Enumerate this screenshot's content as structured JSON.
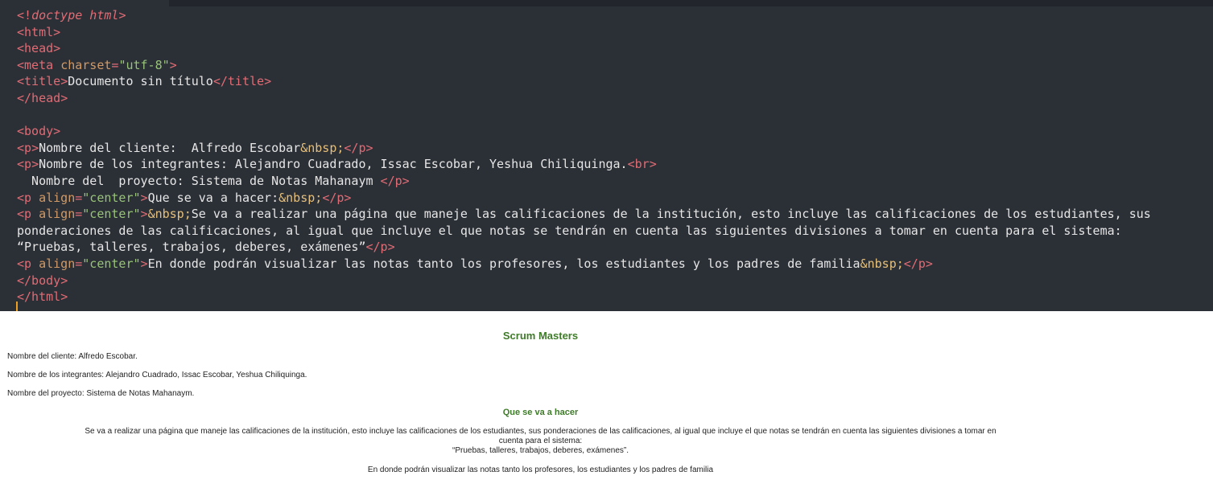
{
  "editor": {
    "lines": [
      "<!doctype html>",
      "<html>",
      "<head>",
      "<meta charset=\"utf-8\">",
      "<title>Documento sin título</title>",
      "</head>",
      "",
      "<body>",
      "<p>Nombre del cliente:  Alfredo Escobar&nbsp;</p>",
      "<p>Nombre de los integrantes: Alejandro Cuadrado, Issac Escobar, Yeshua Chiliquinga.<br>",
      "  Nombre del  proyecto: Sistema de Notas Mahanaym </p>",
      "<p align=\"center\">Que se va a hacer:&nbsp;</p>",
      "<p align=\"center\">&nbsp;Se va a realizar una página que maneje las calificaciones de la institución, esto incluye las calificaciones de los estudiantes, sus",
      "ponderaciones de las calificaciones, al igual que incluye el que notas se tendrán en cuenta las siguientes divisiones a tomar en cuenta para el sistema:",
      "“Pruebas, talleres, trabajos, deberes, exámenes”</p>",
      "<p align=\"center\">En donde podrán visualizar las notas tanto los profesores, los estudiantes y los padres de familia&nbsp;</p>",
      "</body>",
      "</html>"
    ]
  },
  "preview": {
    "title": "Scrum Masters",
    "client": "Nombre del cliente: Alfredo Escobar.",
    "members": "Nombre de los integrantes: Alejandro Cuadrado, Issac Escobar, Yeshua Chiliquinga.",
    "project": "Nombre del proyecto: Sistema de Notas Mahanaym.",
    "section_heading": "Que se va a hacer",
    "description_line1": "Se va a realizar una página que maneje las calificaciones de la institución, esto incluye las calificaciones de los estudiantes, sus ponderaciones de las calificaciones, al igual que incluye el que notas se tendrán en cuenta las siguientes divisiones a tomar en",
    "description_line2": "cuenta para el sistema:",
    "description_line3": "“Pruebas, talleres, trabajos, deberes, exámenes”.",
    "closing": "En donde podrán visualizar las notas tanto los profesores, los estudiantes y los padres de familia"
  },
  "colors": {
    "editor_bg": "#2b2f36",
    "tag": "#e06c75",
    "attribute": "#d19a66",
    "string": "#98c379",
    "heading_green": "#3f7b2a"
  }
}
